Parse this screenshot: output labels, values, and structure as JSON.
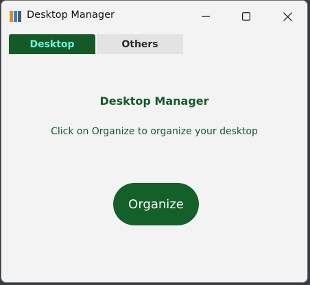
{
  "window": {
    "title": "Desktop Manager",
    "controls": {
      "minimize_icon": "minimize-icon",
      "maximize_icon": "maximize-icon",
      "close_icon": "close-icon"
    }
  },
  "tabs": [
    {
      "label": "Desktop",
      "active": true
    },
    {
      "label": "Others",
      "active": false
    }
  ],
  "main": {
    "heading": "Desktop Manager",
    "description": "Click on Organize to organize your desktop",
    "organize_label": "Organize"
  },
  "colors": {
    "accent_green": "#145a27",
    "active_tab_text": "#6ff0e0",
    "button_green": "#14602a"
  }
}
